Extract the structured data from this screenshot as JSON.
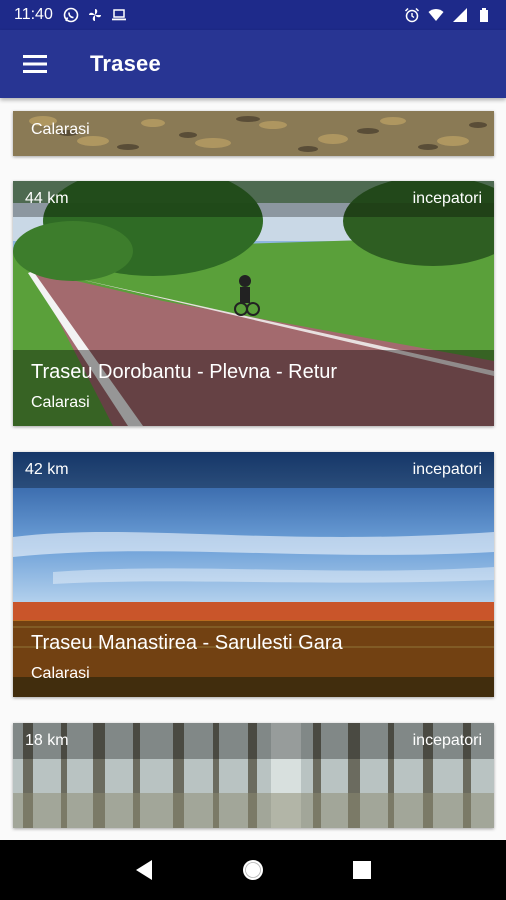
{
  "status_bar": {
    "time": "11:40",
    "left_icons": [
      "whatsapp-icon",
      "fan-icon",
      "laptop-icon"
    ],
    "right_icons": [
      "alarm-icon",
      "wifi-icon",
      "signal-icon",
      "battery-icon"
    ]
  },
  "app_bar": {
    "title": "Trasee",
    "menu_icon": "hamburger-menu-icon"
  },
  "routes": [
    {
      "distance": "",
      "level": "",
      "title": "",
      "region": "Calarasi"
    },
    {
      "distance": "44 km",
      "level": "incepatori",
      "title": "Traseu Dorobantu - Plevna - Retur",
      "region": "Calarasi"
    },
    {
      "distance": "42 km",
      "level": "incepatori",
      "title": "Traseu Manastirea - Sarulesti Gara",
      "region": "Calarasi"
    },
    {
      "distance": "18 km",
      "level": "incepatori",
      "title": "",
      "region": ""
    }
  ],
  "nav_bar": {
    "back_icon": "back-triangle-icon",
    "home_icon": "home-circle-icon",
    "recents_icon": "recents-square-icon"
  },
  "colors": {
    "status_bar": "#1e2a8a",
    "app_bar": "#283593"
  }
}
